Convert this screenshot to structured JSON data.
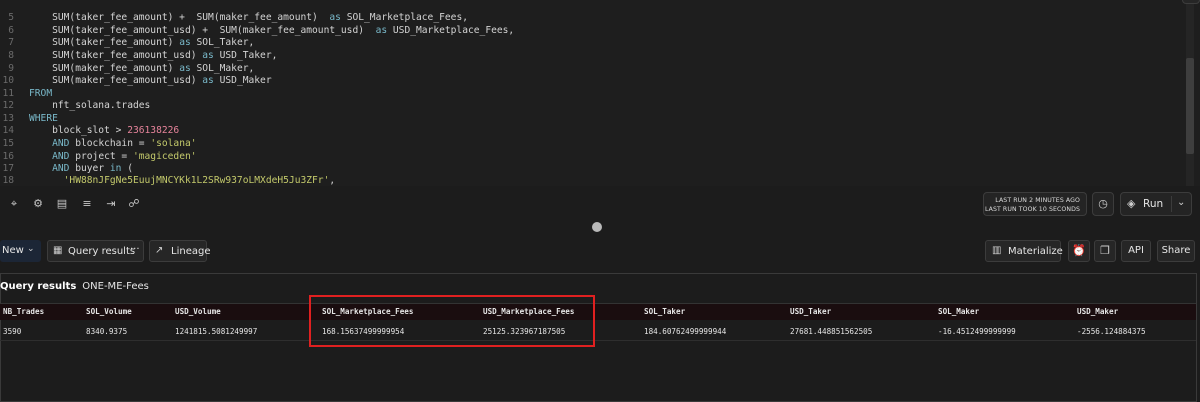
{
  "editor": {
    "lines": [
      {
        "n": "5",
        "parts": [
          [
            "fn",
            "    SUM(taker_fee_amount) +  SUM(maker_fee_amount)  "
          ],
          [
            "kw",
            "as"
          ],
          [
            "fn",
            " SOL_Marketplace_Fees,"
          ]
        ]
      },
      {
        "n": "6",
        "parts": [
          [
            "fn",
            "    SUM(taker_fee_amount_usd) +  SUM(maker_fee_amount_usd)  "
          ],
          [
            "kw",
            "as"
          ],
          [
            "fn",
            " USD_Marketplace_Fees,"
          ]
        ]
      },
      {
        "n": "7",
        "parts": [
          [
            "fn",
            "    SUM(taker_fee_amount) "
          ],
          [
            "kw",
            "as"
          ],
          [
            "fn",
            " SOL_Taker,"
          ]
        ]
      },
      {
        "n": "8",
        "parts": [
          [
            "fn",
            "    SUM(taker_fee_amount_usd) "
          ],
          [
            "kw",
            "as"
          ],
          [
            "fn",
            " USD_Taker,"
          ]
        ]
      },
      {
        "n": "9",
        "parts": [
          [
            "fn",
            "    SUM(maker_fee_amount) "
          ],
          [
            "kw",
            "as"
          ],
          [
            "fn",
            " SOL_Maker,"
          ]
        ]
      },
      {
        "n": "10",
        "parts": [
          [
            "fn",
            "    SUM(maker_fee_amount_usd) "
          ],
          [
            "kw",
            "as"
          ],
          [
            "fn",
            " USD_Maker"
          ]
        ]
      },
      {
        "n": "11",
        "parts": [
          [
            "kw",
            "FROM"
          ]
        ]
      },
      {
        "n": "12",
        "parts": [
          [
            "fn",
            "    nft_solana.trades"
          ]
        ]
      },
      {
        "n": "13",
        "parts": [
          [
            "kw",
            "WHERE"
          ]
        ]
      },
      {
        "n": "14",
        "parts": [
          [
            "fn",
            "    block_slot > "
          ],
          [
            "num",
            "236138226"
          ]
        ]
      },
      {
        "n": "15",
        "parts": [
          [
            "fn",
            "    "
          ],
          [
            "kw",
            "AND"
          ],
          [
            "fn",
            " blockchain = "
          ],
          [
            "str",
            "'solana'"
          ]
        ]
      },
      {
        "n": "16",
        "parts": [
          [
            "fn",
            "    "
          ],
          [
            "kw",
            "AND"
          ],
          [
            "fn",
            " project = "
          ],
          [
            "str",
            "'magiceden'"
          ]
        ]
      },
      {
        "n": "17",
        "parts": [
          [
            "fn",
            "    "
          ],
          [
            "kw",
            "AND"
          ],
          [
            "fn",
            " buyer "
          ],
          [
            "kw",
            "in"
          ],
          [
            "fn",
            " ("
          ]
        ]
      },
      {
        "n": "18",
        "parts": [
          [
            "fn",
            "      "
          ],
          [
            "str",
            "'HW88nJFgNe5EuujMNCYKk1L2SRw937oLMXdeH5Ju3ZFr'"
          ],
          [
            "fn",
            ","
          ]
        ]
      }
    ]
  },
  "toolbar": {
    "icons": [
      "target-icon",
      "settings-icon",
      "format-icon",
      "list-ordered-icon",
      "indent-icon",
      "share-nodes-icon"
    ],
    "last_run": "LAST RUN 2 MINUTES AGO",
    "last_run_took": "LAST RUN TOOK 10 SECONDS",
    "run_label": "Run"
  },
  "results_toolbar": {
    "new_label": "New",
    "tab_label": "Query results",
    "more": "···",
    "lineage_label": "Lineage",
    "materialize_label": "Materialize",
    "api_label": "API",
    "share_label": "Share"
  },
  "results": {
    "title": "Query results",
    "query_name": "ONE-ME-Fees",
    "columns": [
      "NB_Trades",
      "SOL_Volume",
      "USD_Volume",
      "SOL_Marketplace_Fees",
      "USD_Marketplace_Fees",
      "SOL_Taker",
      "USD_Taker",
      "SOL_Maker",
      "USD_Maker"
    ],
    "rows": [
      [
        "3590",
        "8340.9375",
        "1241815.5081249997",
        "168.15637499999954",
        "25125.323967187505",
        "184.60762499999944",
        "27681.448851562505",
        "-16.4512499999999",
        "-2556.124884375"
      ]
    ],
    "highlight_color": "#e02020"
  }
}
